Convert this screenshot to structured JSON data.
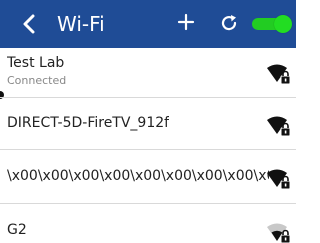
{
  "header": {
    "title": "Wi-Fi",
    "back_icon": "chevron-left-icon",
    "add_icon": "plus-icon",
    "refresh_icon": "refresh-icon",
    "toggle_on": true,
    "bg_color": "#1f4c96",
    "toggle_color": "#22cc22"
  },
  "networks": [
    {
      "name": "Test Lab",
      "status": "Connected",
      "icon": "wifi-locked-icon",
      "signal": "full"
    },
    {
      "name": "DIRECT-5D-FireTV_912f",
      "status": "",
      "icon": "wifi-locked-icon",
      "signal": "full"
    },
    {
      "name": "\\x00\\x00\\x00\\x00\\x00\\x00\\x00\\x00\\x0...",
      "status": "",
      "icon": "wifi-locked-icon",
      "signal": "full"
    },
    {
      "name": "G2",
      "status": "",
      "icon": "wifi-locked-icon",
      "signal": "weak"
    }
  ]
}
